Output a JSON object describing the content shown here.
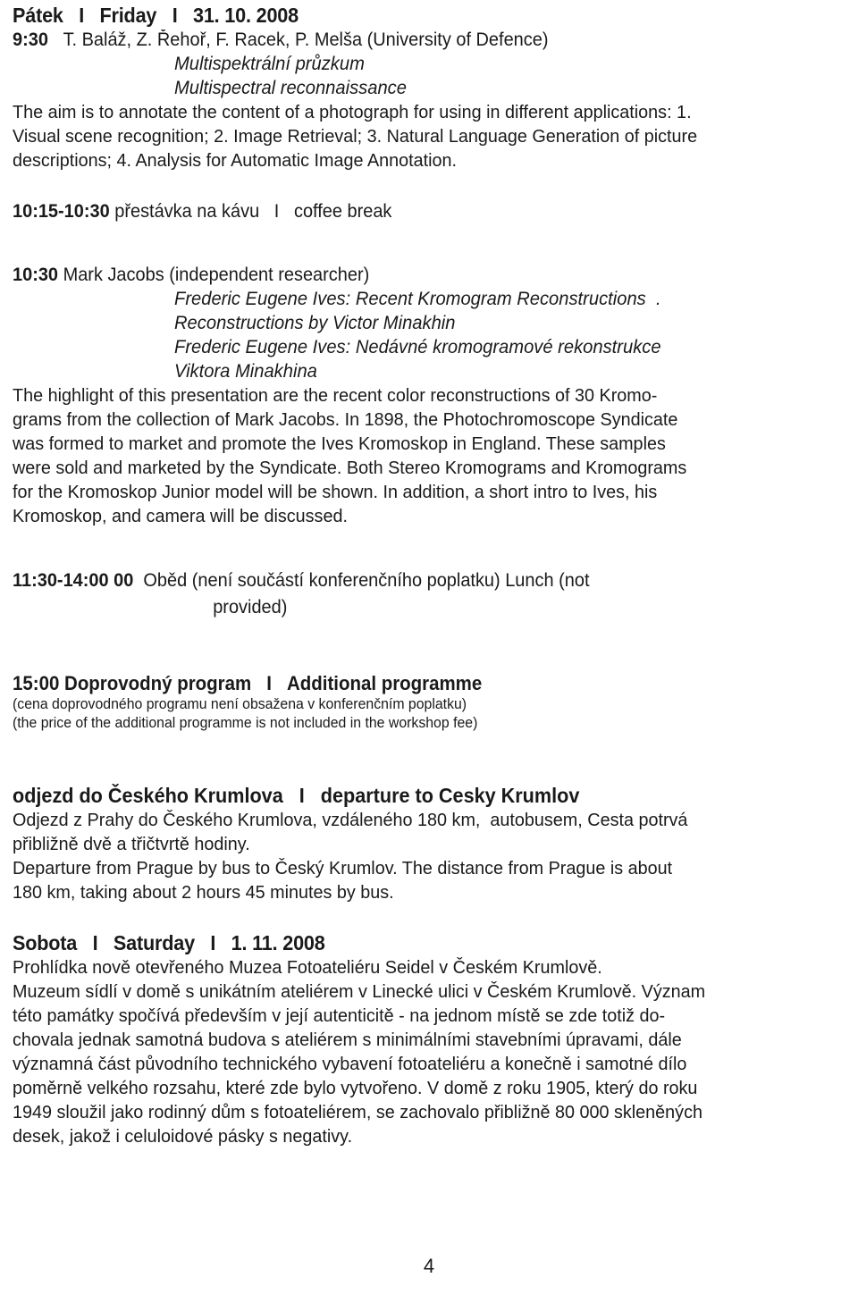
{
  "document": {
    "page_number": "4"
  },
  "friday": {
    "heading": {
      "day_cs": "Pátek",
      "separator": "I",
      "day_en": "Friday",
      "date": "31. 10. 2008"
    },
    "talk1": {
      "time": "9:30",
      "authors": "T. Baláž, Z. Řehoř, F. Racek, P. Melša (University of Defence)",
      "title_cs": "Multispektrální průzkum",
      "title_en": "Multispectral reconnaissance",
      "abstract_lines": [
        "The aim is to annotate the content of a photograph for using in different applications: 1.",
        "Visual scene recognition; 2. Image Retrieval; 3. Natural Language Generation of picture",
        "descriptions; 4. Analysis for Automatic Image Annotation."
      ]
    },
    "break": {
      "time": "10:15-10:30",
      "label_cs": "přestávka na kávu",
      "separator": "I",
      "label_en": "coffee break"
    },
    "talk2": {
      "time": "10:30",
      "authors": "Mark Jacobs (independent researcher)",
      "title_en_line1": "Frederic Eugene Ives: Recent Kromogram Reconstructions  .",
      "title_en_line2": "Reconstructions by Victor Minakhin",
      "title_cs_line1": "Frederic Eugene Ives: Nedávné kromogramové rekonstrukce",
      "title_cs_line2": "Viktora Minakhina",
      "abstract_lines": [
        "The highlight of this presentation are the recent color reconstructions of 30 Kromo-",
        "grams from the collection of Mark Jacobs. In 1898, the Photochromoscope Syndicate",
        "was formed to market and promote the Ives Kromoskop in England. These samples",
        "were sold and marketed by the Syndicate. Both Stereo Kromograms and Kromograms",
        "for the Kromoskop Junior model will be shown. In addition, a short intro to Ives, his",
        "Kromoskop, and camera will be discussed."
      ]
    },
    "lunch": {
      "time": "11:30-14:00 00",
      "text_line1": "Oběd (není součástí konferenčního poplatku) Lunch (not",
      "text_line2": "provided)"
    },
    "additional_programme": {
      "time": "15:00",
      "title_cs": "Doprovodný program",
      "separator": "I",
      "title_en": "Additional programme",
      "note_cs": "(cena doprovodného programu není obsažena v konferenčním poplatku)",
      "note_en": "(the price of the additional programme is not included in the workshop fee)"
    },
    "departure": {
      "title_cs": "odjezd do Českého Krumlova",
      "separator": "I",
      "title_en": "departure to Cesky Krumlov",
      "lines": [
        "Odjezd z Prahy do Českého Krumlova, vzdáleného 180 km,  autobusem, Cesta potrvá",
        "přibližně dvě a třičtvrtě hodiny.",
        "Departure from Prague by bus to Český Krumlov. The distance from Prague is about",
        "180 km, taking about 2 hours 45 minutes by bus."
      ]
    }
  },
  "saturday": {
    "heading": {
      "day_cs": "Sobota",
      "separator": "I",
      "day_en": "Saturday",
      "date": "1. 11. 2008"
    },
    "lines": [
      "Prohlídka nově otevřeného Muzea Fotoateliéru Seidel v Českém Krumlově.",
      "Muzeum sídlí v domě s unikátním ateliérem v Linecké ulici v Českém Krumlově. Význam",
      "této památky spočívá především v její autenticitě - na jednom místě se zde totiž do-",
      "chovala jednak samotná budova s ateliérem s minimálními stavebními úpravami, dále",
      "významná část původního technického vybavení fotoateliéru a konečně i samotné dílo",
      "poměrně velkého rozsahu, které zde bylo vytvořeno. V domě z roku 1905, který do roku",
      "1949 sloužil jako rodinný dům s fotoateliérem, se zachovalo přibližně 80 000 skleněných",
      "desek, jakož i celuloidové pásky s negativy."
    ]
  }
}
